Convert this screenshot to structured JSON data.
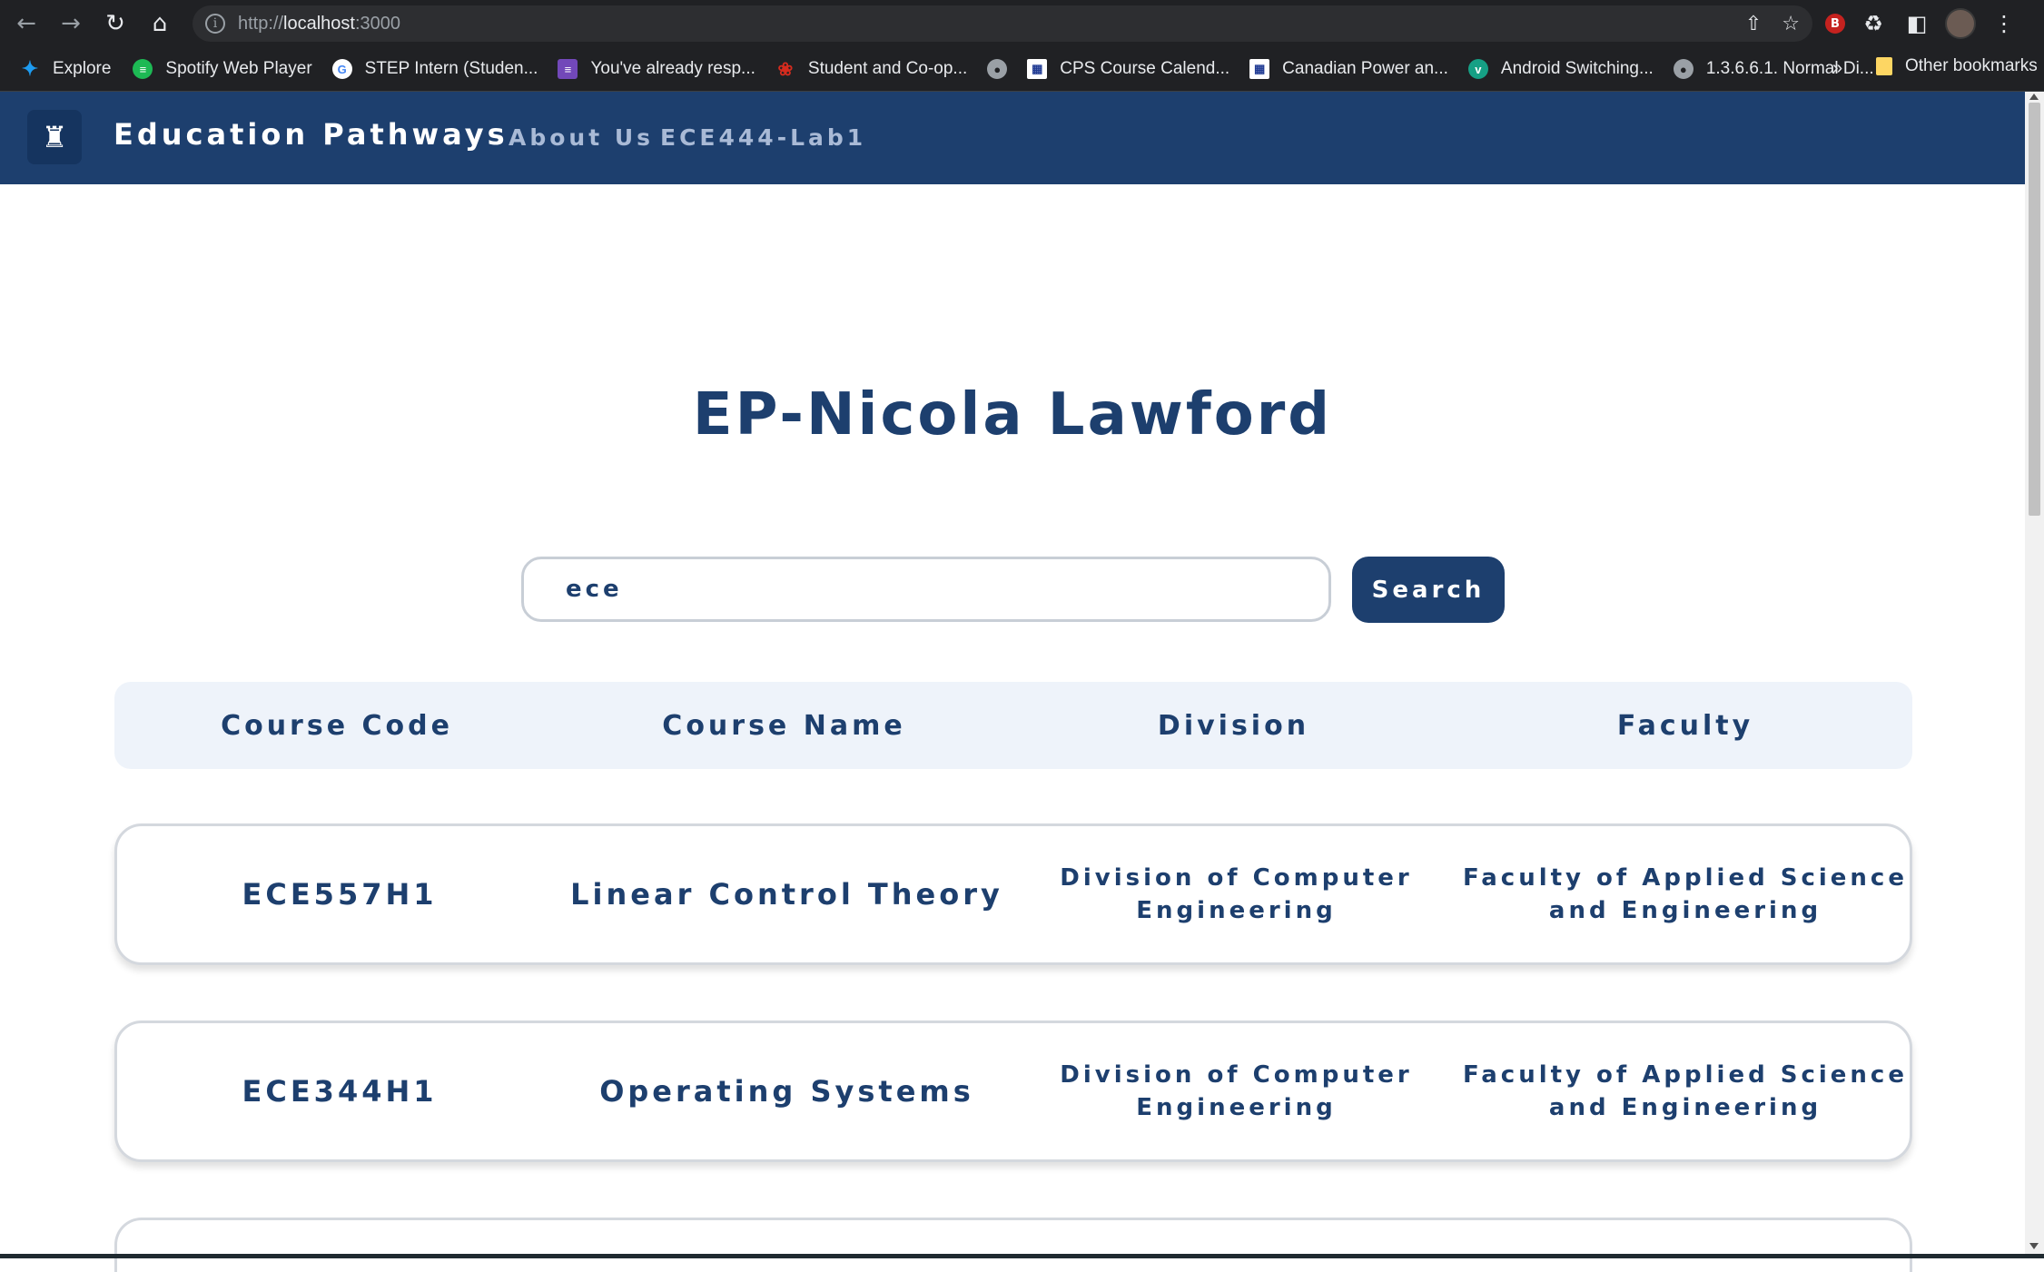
{
  "browser": {
    "url_prefix": "http://",
    "url_host": "localhost",
    "url_port": ":3000",
    "bookmarks": [
      {
        "label": "Explore",
        "icon": "twitter-icon",
        "color": "#1d9bf0"
      },
      {
        "label": "Spotify Web Player",
        "icon": "spotify-icon",
        "color": "#1db954"
      },
      {
        "label": "STEP Intern (Studen...",
        "icon": "google-icon",
        "color": "#ffffff"
      },
      {
        "label": "You've already resp...",
        "icon": "forms-icon",
        "color": "#7248b9"
      },
      {
        "label": "Student and Co-op...",
        "icon": "maple-leaf-icon",
        "color": "#d52b1e"
      },
      {
        "label": "",
        "icon": "globe-icon",
        "color": "#9aa0a6"
      },
      {
        "label": "CPS Course Calend...",
        "icon": "calendar-site-icon",
        "color": "#1f3a93"
      },
      {
        "label": "Canadian Power an...",
        "icon": "calendar-site-icon",
        "color": "#1f3a93"
      },
      {
        "label": "Android Switching...",
        "icon": "vimeo-icon",
        "color": "#1ab7ea"
      },
      {
        "label": "1.3.6.6.1. Normal Di...",
        "icon": "globe-icon",
        "color": "#9aa0a6"
      }
    ],
    "bookmarks_more": "»",
    "other_bookmarks": "Other bookmarks"
  },
  "navbar": {
    "brand": "Education Pathways",
    "links": [
      "About Us",
      "ECE444-Lab1"
    ]
  },
  "page": {
    "title": "EP-Nicola Lawford"
  },
  "search": {
    "value": "ece",
    "button_label": "Search"
  },
  "table": {
    "headers": [
      "Course Code",
      "Course Name",
      "Division",
      "Faculty"
    ],
    "rows": [
      {
        "code": "ECE557H1",
        "name": "Linear Control Theory",
        "division_line1": "Division of Computer",
        "division_line2": "Engineering",
        "faculty_line1": "Faculty of Applied Science",
        "faculty_line2": "and Engineering"
      },
      {
        "code": "ECE344H1",
        "name": "Operating Systems",
        "division_line1": "Division of Computer",
        "division_line2": "Engineering",
        "faculty_line1": "Faculty of Applied Science",
        "faculty_line2": "and Engineering"
      },
      {
        "code": "",
        "name": "",
        "division_line1": "",
        "division_line2": "",
        "faculty_line1": "",
        "faculty_line2": ""
      }
    ]
  },
  "colors": {
    "primary": "#1d3f6e",
    "header_bg": "#eef3fa",
    "nav_link": "#a9bad6"
  }
}
